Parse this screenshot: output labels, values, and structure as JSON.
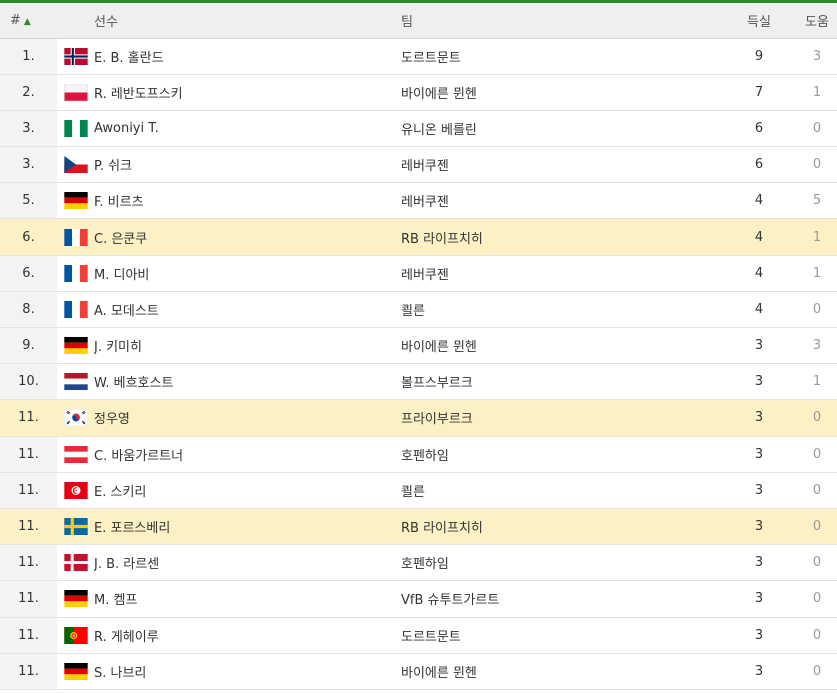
{
  "header": {
    "rank": "#",
    "player": "선수",
    "team": "팀",
    "goals": "득실",
    "assists": "도움"
  },
  "colors": {
    "accent": "#2d8a2d",
    "highlight_row": "#fbf1c4"
  },
  "rows": [
    {
      "rank": "1.",
      "flag": "norway",
      "player": "E. B. 홀란드",
      "team": "도르트문트",
      "goals": "9",
      "assists": "3",
      "highlight": false
    },
    {
      "rank": "2.",
      "flag": "poland",
      "player": "R. 레반도프스키",
      "team": "바이에른 뮌헨",
      "goals": "7",
      "assists": "1",
      "highlight": false
    },
    {
      "rank": "3.",
      "flag": "nigeria",
      "player": "Awoniyi T.",
      "team": "유니온 베를린",
      "goals": "6",
      "assists": "0",
      "highlight": false
    },
    {
      "rank": "3.",
      "flag": "czech",
      "player": "P. 쉬크",
      "team": "레버쿠젠",
      "goals": "6",
      "assists": "0",
      "highlight": false
    },
    {
      "rank": "5.",
      "flag": "germany",
      "player": "F. 비르츠",
      "team": "레버쿠젠",
      "goals": "4",
      "assists": "5",
      "highlight": false
    },
    {
      "rank": "6.",
      "flag": "france",
      "player": "C. 은쿤쿠",
      "team": "RB 라이프치히",
      "goals": "4",
      "assists": "1",
      "highlight": true
    },
    {
      "rank": "6.",
      "flag": "france",
      "player": "M. 디아비",
      "team": "레버쿠젠",
      "goals": "4",
      "assists": "1",
      "highlight": false
    },
    {
      "rank": "8.",
      "flag": "france",
      "player": "A. 모데스트",
      "team": "쾰른",
      "goals": "4",
      "assists": "0",
      "highlight": false
    },
    {
      "rank": "9.",
      "flag": "germany",
      "player": "J. 키미히",
      "team": "바이에른 뮌헨",
      "goals": "3",
      "assists": "3",
      "highlight": false
    },
    {
      "rank": "10.",
      "flag": "netherlands",
      "player": "W. 베흐호스트",
      "team": "볼프스부르크",
      "goals": "3",
      "assists": "1",
      "highlight": false
    },
    {
      "rank": "11.",
      "flag": "korea",
      "player": "정우영",
      "team": "프라이부르크",
      "goals": "3",
      "assists": "0",
      "highlight": true
    },
    {
      "rank": "11.",
      "flag": "austria",
      "player": "C. 바움가르트너",
      "team": "호펜하임",
      "goals": "3",
      "assists": "0",
      "highlight": false
    },
    {
      "rank": "11.",
      "flag": "tunisia",
      "player": "E. 스키리",
      "team": "쾰른",
      "goals": "3",
      "assists": "0",
      "highlight": false
    },
    {
      "rank": "11.",
      "flag": "sweden",
      "player": "E. 포르스베리",
      "team": "RB 라이프치히",
      "goals": "3",
      "assists": "0",
      "highlight": true
    },
    {
      "rank": "11.",
      "flag": "denmark",
      "player": "J. B. 라르센",
      "team": "호펜하임",
      "goals": "3",
      "assists": "0",
      "highlight": false
    },
    {
      "rank": "11.",
      "flag": "germany",
      "player": "M. 켐프",
      "team": "VfB 슈투트가르트",
      "goals": "3",
      "assists": "0",
      "highlight": false
    },
    {
      "rank": "11.",
      "flag": "portugal",
      "player": "R. 게헤이루",
      "team": "도르트문트",
      "goals": "3",
      "assists": "0",
      "highlight": false
    },
    {
      "rank": "11.",
      "flag": "germany",
      "player": "S. 나브리",
      "team": "바이에른 뮌헨",
      "goals": "3",
      "assists": "0",
      "highlight": false
    }
  ]
}
